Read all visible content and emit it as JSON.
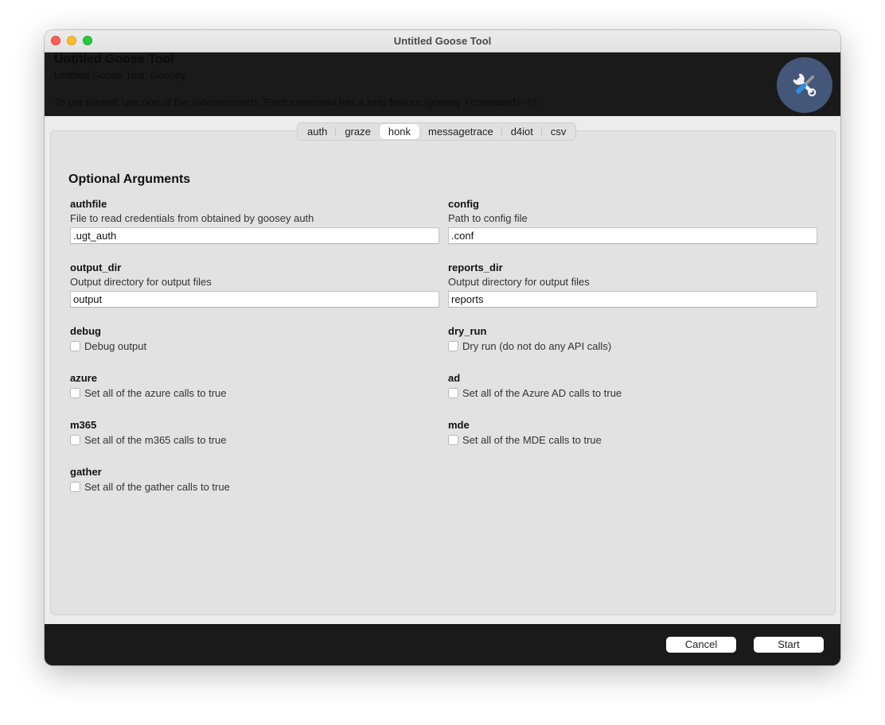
{
  "window": {
    "title": "Untitled Goose Tool",
    "traffic_lights": [
      "close",
      "minimize",
      "zoom"
    ]
  },
  "header": {
    "title": "Untitled Goose Tool",
    "subtitle": "Untitled Goose Tool: Goosey",
    "description": "To get started, use one of the subcommands. Each command has a help feature (goosey <command> -h).",
    "logo_icon": "tools-icon",
    "logo_bg": "#44577a"
  },
  "tabs": [
    {
      "label": "auth",
      "active": false
    },
    {
      "label": "graze",
      "active": false
    },
    {
      "label": "honk",
      "active": true
    },
    {
      "label": "messagetrace",
      "active": false
    },
    {
      "label": "d4iot",
      "active": false
    },
    {
      "label": "csv",
      "active": false
    }
  ],
  "section_title": "Optional Arguments",
  "fields": {
    "authfile": {
      "name": "authfile",
      "description": "File to read credentials from obtained by goosey auth",
      "value": ".ugt_auth"
    },
    "config": {
      "name": "config",
      "description": "Path to config file",
      "value": ".conf"
    },
    "output_dir": {
      "name": "output_dir",
      "description": "Output directory for output files",
      "value": "output"
    },
    "reports_dir": {
      "name": "reports_dir",
      "description": "Output directory for output files",
      "value": "reports"
    }
  },
  "checkboxes": {
    "debug": {
      "name": "debug",
      "label": "Debug output",
      "checked": false
    },
    "dry_run": {
      "name": "dry_run",
      "label": "Dry run (do not do any API calls)",
      "checked": false
    },
    "azure": {
      "name": "azure",
      "label": "Set all of the azure calls to true",
      "checked": false
    },
    "ad": {
      "name": "ad",
      "label": "Set all of the Azure AD calls to true",
      "checked": false
    },
    "m365": {
      "name": "m365",
      "label": "Set all of the m365 calls to true",
      "checked": false
    },
    "mde": {
      "name": "mde",
      "label": "Set all of the MDE calls to true",
      "checked": false
    },
    "gather": {
      "name": "gather",
      "label": "Set all of the gather calls to true",
      "checked": false
    }
  },
  "footer": {
    "cancel_label": "Cancel",
    "start_label": "Start"
  }
}
